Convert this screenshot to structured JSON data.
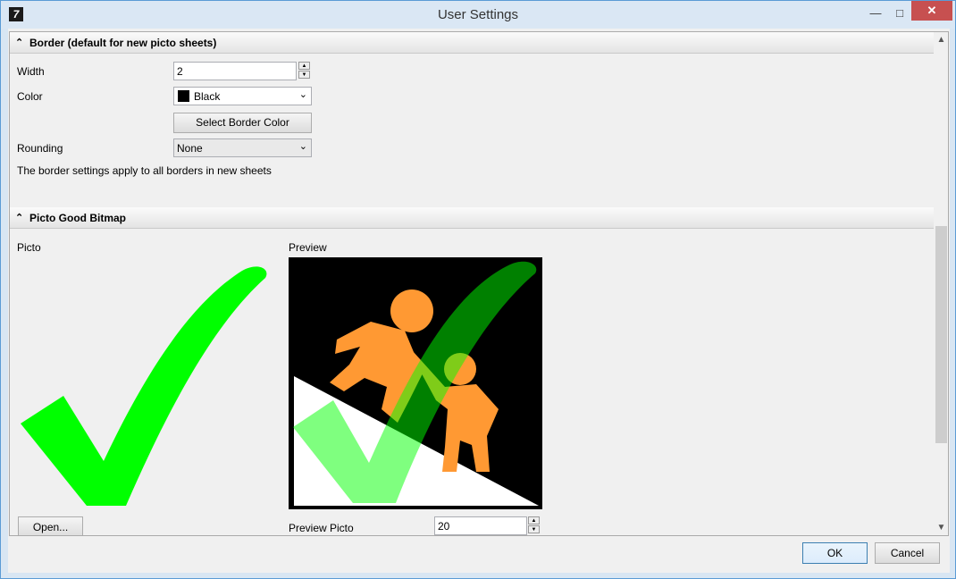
{
  "window": {
    "title": "User Settings",
    "controls": {
      "minimize": "—",
      "maximize": "□",
      "close": "✕"
    }
  },
  "border_section": {
    "header": "Border (default for new picto sheets)",
    "width_label": "Width",
    "width_value": "2",
    "color_label": "Color",
    "color_value": "Black",
    "color_swatch": "#000000",
    "select_color_button": "Select Border Color",
    "rounding_label": "Rounding",
    "rounding_value": "None",
    "note": "The border settings apply to all borders in new sheets"
  },
  "picto_section": {
    "header": "Picto Good Bitmap",
    "picto_label": "Picto",
    "preview_label": "Preview",
    "open_button": "Open...",
    "preview_picto_label": "Preview Picto",
    "preview_picto_value": "20",
    "check_color": "#00ff00",
    "figure_color": "#ff9933"
  },
  "dialog_buttons": {
    "ok": "OK",
    "cancel": "Cancel"
  },
  "icons": {
    "collapse": "double-chevron-up-icon",
    "dropdown": "chevron-down-icon"
  }
}
